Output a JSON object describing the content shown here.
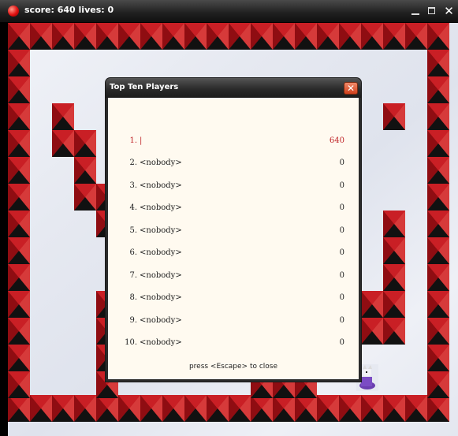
{
  "window": {
    "title": "score: 640 lives: 0",
    "icons": {
      "app": "red-ball-icon",
      "minimize": "minimize-icon",
      "maximize": "maximize-icon",
      "close": "close-x-icon"
    },
    "close_glyph": "✕"
  },
  "colors": {
    "titlebar": "#2a2a2a",
    "tile_red": "#b8141a",
    "tile_dark": "#111111",
    "snow": "#e6e9f1",
    "dialog_body": "#fffaf0",
    "highlight_text": "#c0262a",
    "close_button": "#e0582e"
  },
  "dialog": {
    "title": "Top Ten Players",
    "close_glyph": "✕",
    "rows": [
      {
        "rank": "1.",
        "name": "|",
        "score": "640"
      },
      {
        "rank": "2.",
        "name": "<nobody>",
        "score": "0"
      },
      {
        "rank": "3.",
        "name": "<nobody>",
        "score": "0"
      },
      {
        "rank": "4.",
        "name": "<nobody>",
        "score": "0"
      },
      {
        "rank": "5.",
        "name": "<nobody>",
        "score": "0"
      },
      {
        "rank": "6.",
        "name": "<nobody>",
        "score": "0"
      },
      {
        "rank": "7.",
        "name": "<nobody>",
        "score": "0"
      },
      {
        "rank": "8.",
        "name": "<nobody>",
        "score": "0"
      },
      {
        "rank": "9.",
        "name": "<nobody>",
        "score": "0"
      },
      {
        "rank": "10.",
        "name": "<nobody>",
        "score": "0"
      }
    ],
    "footer": "press <Escape> to close"
  }
}
